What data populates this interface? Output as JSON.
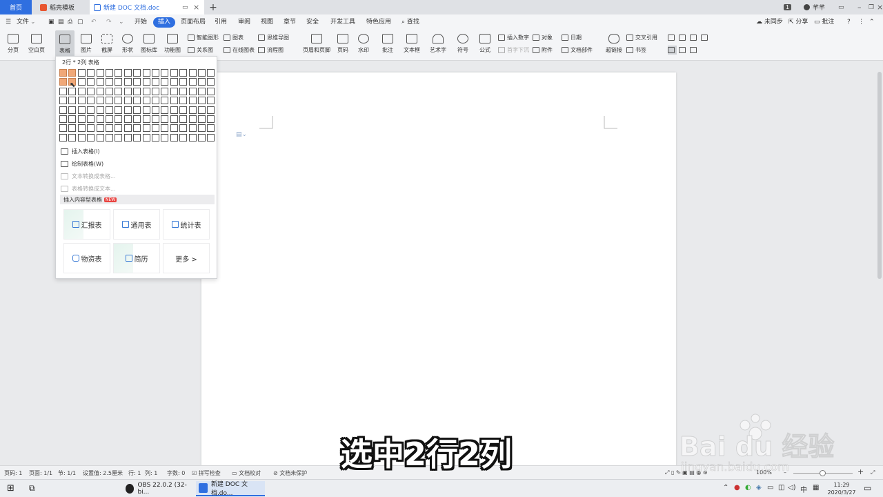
{
  "titlebar": {
    "tabs": [
      {
        "label": "首页"
      },
      {
        "label": "稻壳模板"
      },
      {
        "label": "新建 DOC 文档.doc"
      }
    ],
    "badge": "1",
    "user": "芊芊"
  },
  "menu": {
    "file": "文件",
    "items": [
      "开始",
      "插入",
      "页面布局",
      "引用",
      "审阅",
      "视图",
      "章节",
      "安全",
      "开发工具",
      "特色应用"
    ],
    "search": "查找",
    "sync": "未同步",
    "share": "分享",
    "comment": "批注",
    "help": "?"
  },
  "ribbon": {
    "page_break": "分页",
    "blank_page": "空白页",
    "table": "表格",
    "image": "图片",
    "screenshot": "截屏",
    "shape": "形状",
    "icon_lib": "图标库",
    "func_chart": "功能图",
    "smart_shape": "智能图形",
    "chart": "图表",
    "mind_map": "思维导图",
    "relation": "关系图",
    "online_chart": "在线图表",
    "flowchart": "流程图",
    "header_footer": "页眉和页脚",
    "page_number": "页码",
    "watermark": "水印",
    "comment": "批注",
    "textbox": "文本框",
    "wordart": "艺术字",
    "symbol": "符号",
    "formula": "公式",
    "insert_number": "插入数字",
    "object": "对象",
    "date": "日期",
    "drop_cap": "首字下沉",
    "attachment": "附件",
    "doc_parts": "文档部件",
    "hyperlink": "超链接",
    "cross_ref": "交叉引用",
    "bookmark": "书签"
  },
  "dropdown": {
    "grid_label": "2行 * 2列 表格",
    "grid_rows": 8,
    "grid_cols": 17,
    "selected_rows": 2,
    "selected_cols": 2,
    "insert_table": "插入表格(I)",
    "draw_table": "绘制表格(W)",
    "text_to_table": "文本转换成表格...",
    "table_to_text": "表格转换成文本...",
    "content_table": "插入内容型表格",
    "new_badge": "NEW",
    "templates": [
      "汇报表",
      "通用表",
      "统计表",
      "物资表",
      "简历",
      "更多 >"
    ]
  },
  "statusbar": {
    "page_code": "页码: 1",
    "page": "页面: 1/1",
    "section": "节: 1/1",
    "setting": "设置值: 2.5厘米",
    "row": "行: 1",
    "col": "列: 1",
    "words": "字数: 0",
    "spell": "拼写检查",
    "proof": "文档校对",
    "protect": "文档未保护",
    "zoom": "100%"
  },
  "taskbar": {
    "obs": "OBS 22.0.2 (32-bi...",
    "wps": "新建 DOC 文档.do...",
    "ime": "中",
    "time": "11:29",
    "date": "2020/3/27"
  },
  "overlay": {
    "caption": "选中2行2列",
    "watermark_brand": "Bai du 经验",
    "watermark_url": "jingyan.baidu.com"
  },
  "colors": {
    "accent": "#2f6fe0",
    "selected_cell": "#f0a878"
  }
}
